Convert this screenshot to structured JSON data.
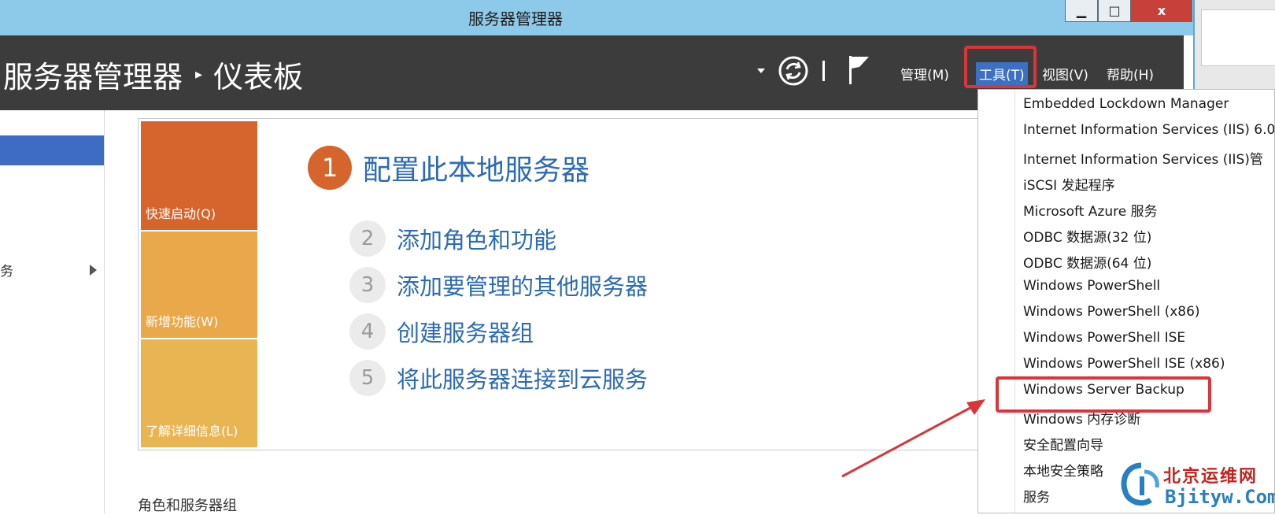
{
  "window": {
    "title": "服务器管理器",
    "buttons": {
      "minimize": "▁",
      "maximize": "□",
      "close": "x"
    }
  },
  "header": {
    "breadcrumb_root": "服务器管理器",
    "breadcrumb_sep": "▸",
    "breadcrumb_current": "仪表板",
    "menus": {
      "manage": "管理(M)",
      "tools": "工具(T)",
      "view": "视图(V)",
      "help": "帮助(H)"
    }
  },
  "leftnav": {
    "partial_item": "务"
  },
  "welcome": {
    "tiles": {
      "quick_start": "快速启动(Q)",
      "whats_new": "新增功能(W)",
      "learn_more": "了解详细信息(L)"
    },
    "steps": [
      {
        "num": "1",
        "text": "配置此本地服务器"
      },
      {
        "num": "2",
        "text": "添加角色和功能"
      },
      {
        "num": "3",
        "text": "添加要管理的其他服务器"
      },
      {
        "num": "4",
        "text": "创建服务器组"
      },
      {
        "num": "5",
        "text": "将此服务器连接到云服务"
      }
    ]
  },
  "section_title": "角色和服务器组",
  "tools_menu": {
    "items": [
      "Embedded Lockdown Manager",
      "Internet Information Services (IIS) 6.0",
      "Internet Information Services (IIS)管",
      "iSCSI 发起程序",
      "Microsoft Azure 服务",
      "ODBC 数据源(32 位)",
      "ODBC 数据源(64 位)",
      "Windows PowerShell",
      "Windows PowerShell (x86)",
      "Windows PowerShell ISE",
      "Windows PowerShell ISE (x86)",
      "Windows Server Backup",
      "Windows 内存诊断",
      "安全配置向导",
      "本地安全策略",
      "服务"
    ]
  },
  "watermark": {
    "cn": "北京运维网",
    "en": "Bjityw.Com"
  },
  "colors": {
    "accent_red": "#d9353a",
    "orange": "#d6652d",
    "link_blue": "#2d6bb5",
    "header_dark": "#3c3c3c"
  }
}
